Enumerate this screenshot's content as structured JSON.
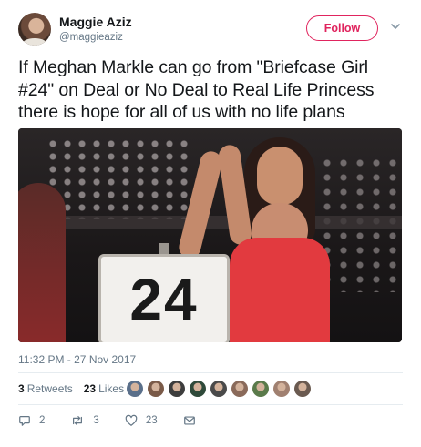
{
  "user": {
    "name": "Maggie Aziz",
    "handle": "@maggieaziz",
    "avatar_icon": "profile-photo"
  },
  "follow_label": "Follow",
  "tweet_text": "If Meghan Markle can go from \"Briefcase Girl #24\" on Deal or No Deal to Real Life Princess there is hope for all of us with no life plans",
  "media": {
    "briefcase_number": "24"
  },
  "timestamp": "11:32 PM - 27 Nov 2017",
  "stats": {
    "retweets_count": "3",
    "retweets_label": "Retweets",
    "likes_count": "23",
    "likes_label": "Likes",
    "liker_avatar_colors": [
      "#5a6f8a",
      "#7a5a48",
      "#3d3d3d",
      "#2f4a3a",
      "#4a4a4a",
      "#8a6a5a",
      "#5a7a4a",
      "#a08070",
      "#6a5a50"
    ]
  },
  "actions": {
    "reply_count": "2",
    "retweet_count": "3",
    "like_count": "23",
    "reply_icon": "reply-icon",
    "retweet_icon": "retweet-icon",
    "like_icon": "heart-icon",
    "dm_icon": "envelope-icon"
  },
  "colors": {
    "follow_accent": "#e0245e",
    "secondary_text": "#657786"
  }
}
